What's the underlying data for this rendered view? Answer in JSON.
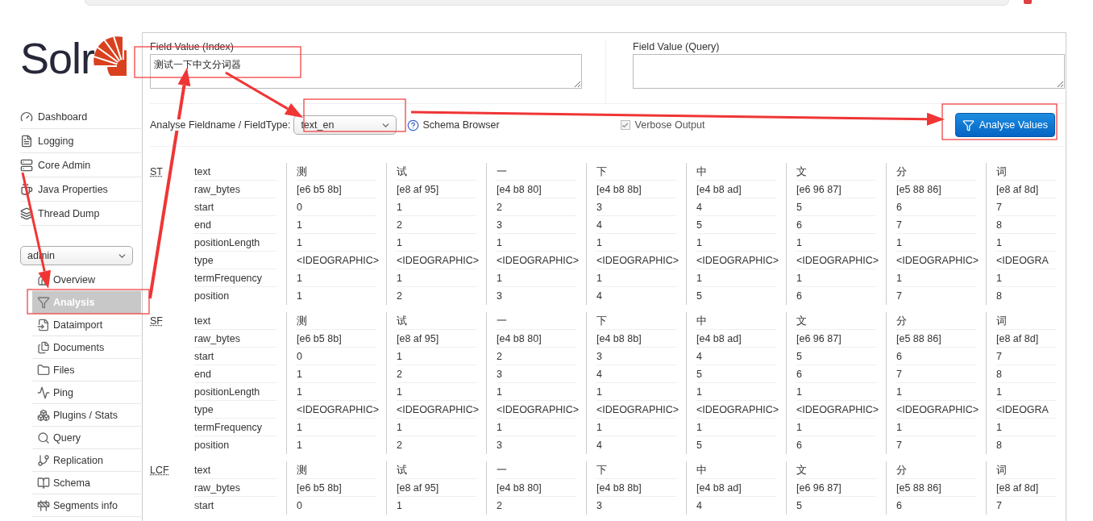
{
  "logo": {
    "text": "Solr"
  },
  "nav": [
    {
      "label": "Dashboard"
    },
    {
      "label": "Logging"
    },
    {
      "label": "Core Admin"
    },
    {
      "label": "Java Properties"
    },
    {
      "label": "Thread Dump"
    }
  ],
  "core_selector": {
    "value": "admin"
  },
  "core_menu": [
    {
      "label": "Overview",
      "selected": false
    },
    {
      "label": "Analysis",
      "selected": true
    },
    {
      "label": "Dataimport",
      "selected": false
    },
    {
      "label": "Documents",
      "selected": false
    },
    {
      "label": "Files",
      "selected": false
    },
    {
      "label": "Ping",
      "selected": false
    },
    {
      "label": "Plugins / Stats",
      "selected": false
    },
    {
      "label": "Query",
      "selected": false
    },
    {
      "label": "Replication",
      "selected": false
    },
    {
      "label": "Schema",
      "selected": false
    },
    {
      "label": "Segments info",
      "selected": false
    }
  ],
  "form": {
    "index_field": {
      "label": "Field Value (Index)",
      "value": "测试一下中文分词器"
    },
    "query_field": {
      "label": "Field Value (Query)"
    },
    "fieldtype": {
      "label": "Analyse Fieldname / FieldType:",
      "value": "text_en"
    },
    "schema_link": "Schema Browser",
    "verbose": {
      "label": "Verbose Output",
      "checked": true
    },
    "analyse_button": "Analyse Values"
  },
  "stages": [
    {
      "name": "ST",
      "rows": [
        {
          "attribute": "text",
          "values": [
            "测",
            "试",
            "一",
            "下",
            "中",
            "文",
            "分",
            "词"
          ]
        },
        {
          "attribute": "raw_bytes",
          "values": [
            "[e6 b5 8b]",
            "[e8 af 95]",
            "[e4 b8 80]",
            "[e4 b8 8b]",
            "[e4 b8 ad]",
            "[e6 96 87]",
            "[e5 88 86]",
            "[e8 af 8d]"
          ]
        },
        {
          "attribute": "start",
          "values": [
            "0",
            "1",
            "2",
            "3",
            "4",
            "5",
            "6",
            "7"
          ]
        },
        {
          "attribute": "end",
          "values": [
            "1",
            "2",
            "3",
            "4",
            "5",
            "6",
            "7",
            "8"
          ]
        },
        {
          "attribute": "positionLength",
          "values": [
            "1",
            "1",
            "1",
            "1",
            "1",
            "1",
            "1",
            "1"
          ]
        },
        {
          "attribute": "type",
          "values": [
            "<IDEOGRAPHIC>",
            "<IDEOGRAPHIC>",
            "<IDEOGRAPHIC>",
            "<IDEOGRAPHIC>",
            "<IDEOGRAPHIC>",
            "<IDEOGRAPHIC>",
            "<IDEOGRAPHIC>",
            "<IDEOGRA"
          ]
        },
        {
          "attribute": "termFrequency",
          "values": [
            "1",
            "1",
            "1",
            "1",
            "1",
            "1",
            "1",
            "1"
          ]
        },
        {
          "attribute": "position",
          "values": [
            "1",
            "2",
            "3",
            "4",
            "5",
            "6",
            "7",
            "8"
          ]
        }
      ]
    },
    {
      "name": "SF",
      "rows": [
        {
          "attribute": "text",
          "values": [
            "测",
            "试",
            "一",
            "下",
            "中",
            "文",
            "分",
            "词"
          ]
        },
        {
          "attribute": "raw_bytes",
          "values": [
            "[e6 b5 8b]",
            "[e8 af 95]",
            "[e4 b8 80]",
            "[e4 b8 8b]",
            "[e4 b8 ad]",
            "[e6 96 87]",
            "[e5 88 86]",
            "[e8 af 8d]"
          ]
        },
        {
          "attribute": "start",
          "values": [
            "0",
            "1",
            "2",
            "3",
            "4",
            "5",
            "6",
            "7"
          ]
        },
        {
          "attribute": "end",
          "values": [
            "1",
            "2",
            "3",
            "4",
            "5",
            "6",
            "7",
            "8"
          ]
        },
        {
          "attribute": "positionLength",
          "values": [
            "1",
            "1",
            "1",
            "1",
            "1",
            "1",
            "1",
            "1"
          ]
        },
        {
          "attribute": "type",
          "values": [
            "<IDEOGRAPHIC>",
            "<IDEOGRAPHIC>",
            "<IDEOGRAPHIC>",
            "<IDEOGRAPHIC>",
            "<IDEOGRAPHIC>",
            "<IDEOGRAPHIC>",
            "<IDEOGRAPHIC>",
            "<IDEOGRA"
          ]
        },
        {
          "attribute": "termFrequency",
          "values": [
            "1",
            "1",
            "1",
            "1",
            "1",
            "1",
            "1",
            "1"
          ]
        },
        {
          "attribute": "position",
          "values": [
            "1",
            "2",
            "3",
            "4",
            "5",
            "6",
            "7",
            "8"
          ]
        }
      ]
    },
    {
      "name": "LCF",
      "rows": [
        {
          "attribute": "text",
          "values": [
            "测",
            "试",
            "一",
            "下",
            "中",
            "文",
            "分",
            "词"
          ]
        },
        {
          "attribute": "raw_bytes",
          "values": [
            "[e6 b5 8b]",
            "[e8 af 95]",
            "[e4 b8 80]",
            "[e4 b8 8b]",
            "[e4 b8 ad]",
            "[e6 96 87]",
            "[e5 88 86]",
            "[e8 af 8d]"
          ]
        },
        {
          "attribute": "start",
          "values": [
            "0",
            "1",
            "2",
            "3",
            "4",
            "5",
            "6",
            "7"
          ]
        }
      ]
    }
  ]
}
